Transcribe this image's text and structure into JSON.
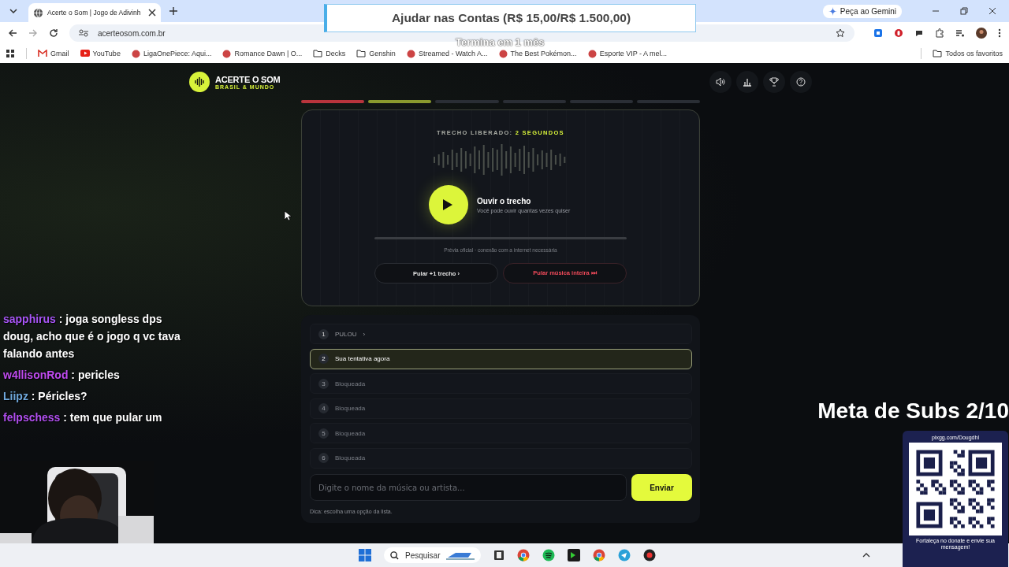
{
  "browser": {
    "tab_title": "Acerte o Som | Jogo de Adivinh",
    "url": "acerteosom.com.br",
    "gemini_button": "Peça ao Gemini",
    "bookmarks": [
      {
        "label": "Gmail",
        "kind": "mail"
      },
      {
        "label": "YouTube",
        "kind": "video"
      },
      {
        "label": "LigaOnePiece: Aqui...",
        "kind": "favicon"
      },
      {
        "label": "Romance Dawn | O...",
        "kind": "favicon"
      },
      {
        "label": "Decks",
        "kind": "folder"
      },
      {
        "label": "Genshin",
        "kind": "folder"
      },
      {
        "label": "Streamed - Watch A...",
        "kind": "favicon"
      },
      {
        "label": "The Best Pokémon...",
        "kind": "favicon"
      },
      {
        "label": "Esporte VIP - A mel...",
        "kind": "favicon"
      }
    ],
    "all_bookmarks": "Todos os favoritos"
  },
  "app": {
    "logo_title": "ACERTE O SOM",
    "logo_subtitle": "BRASIL & MUNDO",
    "progress": [
      {
        "kind": "skipped"
      },
      {
        "kind": "current"
      },
      {
        "kind": "locked"
      },
      {
        "kind": "locked"
      },
      {
        "kind": "locked"
      },
      {
        "kind": "locked"
      }
    ],
    "snippet_label": "TRECHO LIBERADO:",
    "snippet_value": "2 SEGUNDOS",
    "play_title": "Ouvir o trecho",
    "play_subtitle": "Você pode ouvir quantas vezes quiser",
    "note": "Prévia oficial · conexão com a internet necessária",
    "skip_one": "Pular +1 trecho ›",
    "skip_all": "Pular música inteira ⏭",
    "attempts": [
      {
        "number": "1",
        "label": "PULOU",
        "mark": "›",
        "kind": "skipped",
        "selected": false
      },
      {
        "number": "2",
        "label": "Sua tentativa agora",
        "kind": "current",
        "selected": true
      },
      {
        "number": "3",
        "label": "Bloqueada",
        "kind": "locked",
        "selected": false
      },
      {
        "number": "4",
        "label": "Bloqueada",
        "kind": "locked",
        "selected": false
      },
      {
        "number": "5",
        "label": "Bloqueada",
        "kind": "locked",
        "selected": false
      },
      {
        "number": "6",
        "label": "Bloqueada",
        "kind": "locked",
        "selected": false
      }
    ],
    "guess": {
      "placeholder": "Digite o nome da música ou artista..."
    },
    "submit": "Enviar",
    "hint": "Dica: escolha uma opção da lista."
  },
  "overlay": {
    "donation": {
      "title": "Ajudar nas Contas (R$ 15,00/R$ 1.500,00)",
      "subtitle": "Termina em 1 mês"
    },
    "chat": [
      {
        "user": "sapphirus",
        "color": "#a855f7",
        "text": ": joga songless dps doug, acho que é o jogo q vc tava falando antes"
      },
      {
        "user": "w4llisonRod",
        "color": "#c04bf0",
        "text": ": pericles"
      },
      {
        "user": "Liipz",
        "color": "#6fa8dc",
        "text": ": Péricles?"
      },
      {
        "user": "felpschess",
        "color": "#b14ff0",
        "text": ": tem que pular um"
      }
    ],
    "subs_goal": "Meta de Subs 2/10",
    "qr": {
      "url": "pixgg.com/Dougdhl",
      "caption": "Fortaleça no donate e envie sua mensagem!"
    }
  },
  "taskbar": {
    "search": "Pesquisar"
  }
}
